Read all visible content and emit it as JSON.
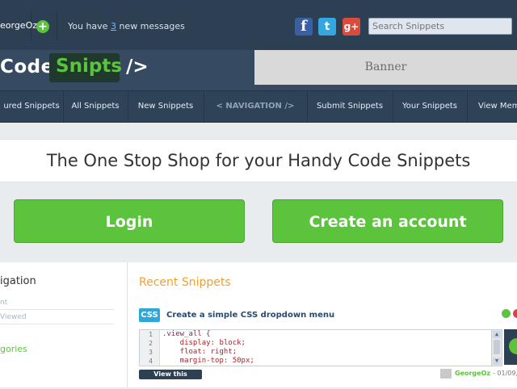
{
  "topbar": {
    "username": "eorgeOz",
    "messages_prefix": "You have ",
    "messages_count": "3",
    "messages_suffix": " new messages",
    "search_placeholder": "Search Snippets",
    "social": [
      "facebook-icon",
      "twitter-icon",
      "google-plus-icon"
    ]
  },
  "header": {
    "logo_code": "Code",
    "logo_snipts": "Snipts",
    "logo_tag": "/>",
    "banner": "Banner"
  },
  "nav": {
    "items": [
      "ured Snippets",
      "All Snippets",
      "New Snippets",
      "< NAVIGATION />",
      "Submit Snippets",
      "Your Snippets",
      "View Mem"
    ]
  },
  "hero": {
    "tagline": "The One Stop Shop for your Handy Code Snippets",
    "login": "Login",
    "create_account": "Create an account"
  },
  "sidebar": {
    "title": "igation",
    "rows": [
      "nt",
      " Viewed"
    ],
    "categories": "gories"
  },
  "recent": {
    "title": "Recent Snippets",
    "snippet": {
      "lang": "CSS",
      "title": "Create a simple CSS dropdown menu",
      "lines": [
        {
          "num": "1",
          "text": ".view_all {"
        },
        {
          "num": "2",
          "text": "    display: block;"
        },
        {
          "num": "3",
          "text": "    float: right;"
        },
        {
          "num": "4",
          "text": "    margin-top: 50px;"
        }
      ],
      "view_button": "View this snippet",
      "author": "GeorgeOz",
      "date": "- 01/09,"
    }
  },
  "colors": {
    "topbar": "#2d3f52",
    "accent_green": "#5cc33c",
    "orange": "#f0a030",
    "css_badge": "#2ea7d9"
  }
}
